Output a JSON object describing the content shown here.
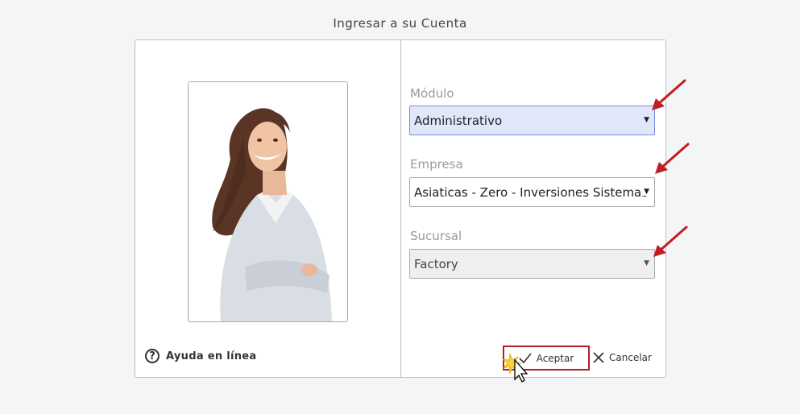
{
  "page": {
    "title": "Ingresar a su Cuenta"
  },
  "left": {
    "help_label": "Ayuda en línea"
  },
  "form": {
    "modulo": {
      "label": "Módulo",
      "value": "Administrativo"
    },
    "empresa": {
      "label": "Empresa",
      "value": "Asiaticas - Zero - Inversiones Sistemas"
    },
    "sucursal": {
      "label": "Sucursal",
      "value": "Factory"
    }
  },
  "actions": {
    "accept_label": "Aceptar",
    "cancel_label": "Cancelar"
  },
  "colors": {
    "accent_red": "#b21e24",
    "selected_select_bg": "#e1e7fb",
    "label_gray": "#9a9a9a"
  },
  "icons": [
    "help-circle-icon",
    "checkmark-icon",
    "close-x-icon",
    "caret-down-icon",
    "pointer-cursor-icon",
    "annotation-arrow-icon"
  ]
}
